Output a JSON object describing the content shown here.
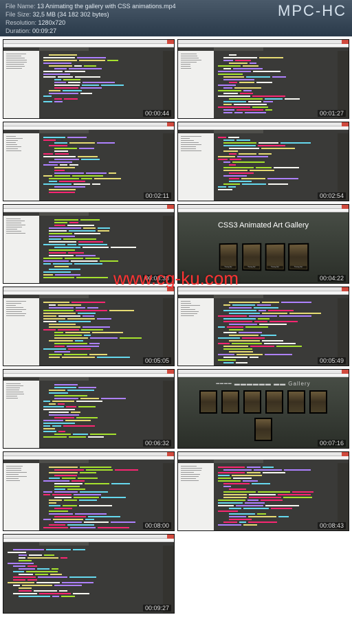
{
  "header": {
    "brand": "MPC-HC",
    "file_name_label": "File Name:",
    "file_name": "13 Animating the gallery with CSS animations.mp4",
    "file_size_label": "File Size:",
    "file_size": "32,5 MB (34 182 302 bytes)",
    "resolution_label": "Resolution:",
    "resolution": "1280x720",
    "duration_label": "Duration:",
    "duration": "00:09:27"
  },
  "watermark": "www.cg-ku.com",
  "gallery": {
    "title": "CSS3 Animated Art Gallery",
    "painting_title": "\"Painting Title\"",
    "painting_sub": "by Artist Name"
  },
  "cells": [
    {
      "ts": "00:00:44",
      "kind": "code",
      "sidebar": true
    },
    {
      "ts": "00:01:27",
      "kind": "code",
      "sidebar": true
    },
    {
      "ts": "00:02:11",
      "kind": "code",
      "sidebar": true
    },
    {
      "ts": "00:02:54",
      "kind": "code",
      "sidebar": true
    },
    {
      "ts": "00:03:38",
      "kind": "code",
      "sidebar": true
    },
    {
      "ts": "00:04:22",
      "kind": "gallery-row"
    },
    {
      "ts": "00:05:05",
      "kind": "code",
      "sidebar": true
    },
    {
      "ts": "00:05:49",
      "kind": "code",
      "sidebar": true
    },
    {
      "ts": "00:06:32",
      "kind": "code",
      "sidebar": true
    },
    {
      "ts": "00:07:16",
      "kind": "gallery-grid"
    },
    {
      "ts": "00:08:00",
      "kind": "code",
      "sidebar": true
    },
    {
      "ts": "00:08:43",
      "kind": "code",
      "sidebar": true
    },
    {
      "ts": "00:09:27",
      "kind": "code",
      "sidebar": false
    }
  ]
}
